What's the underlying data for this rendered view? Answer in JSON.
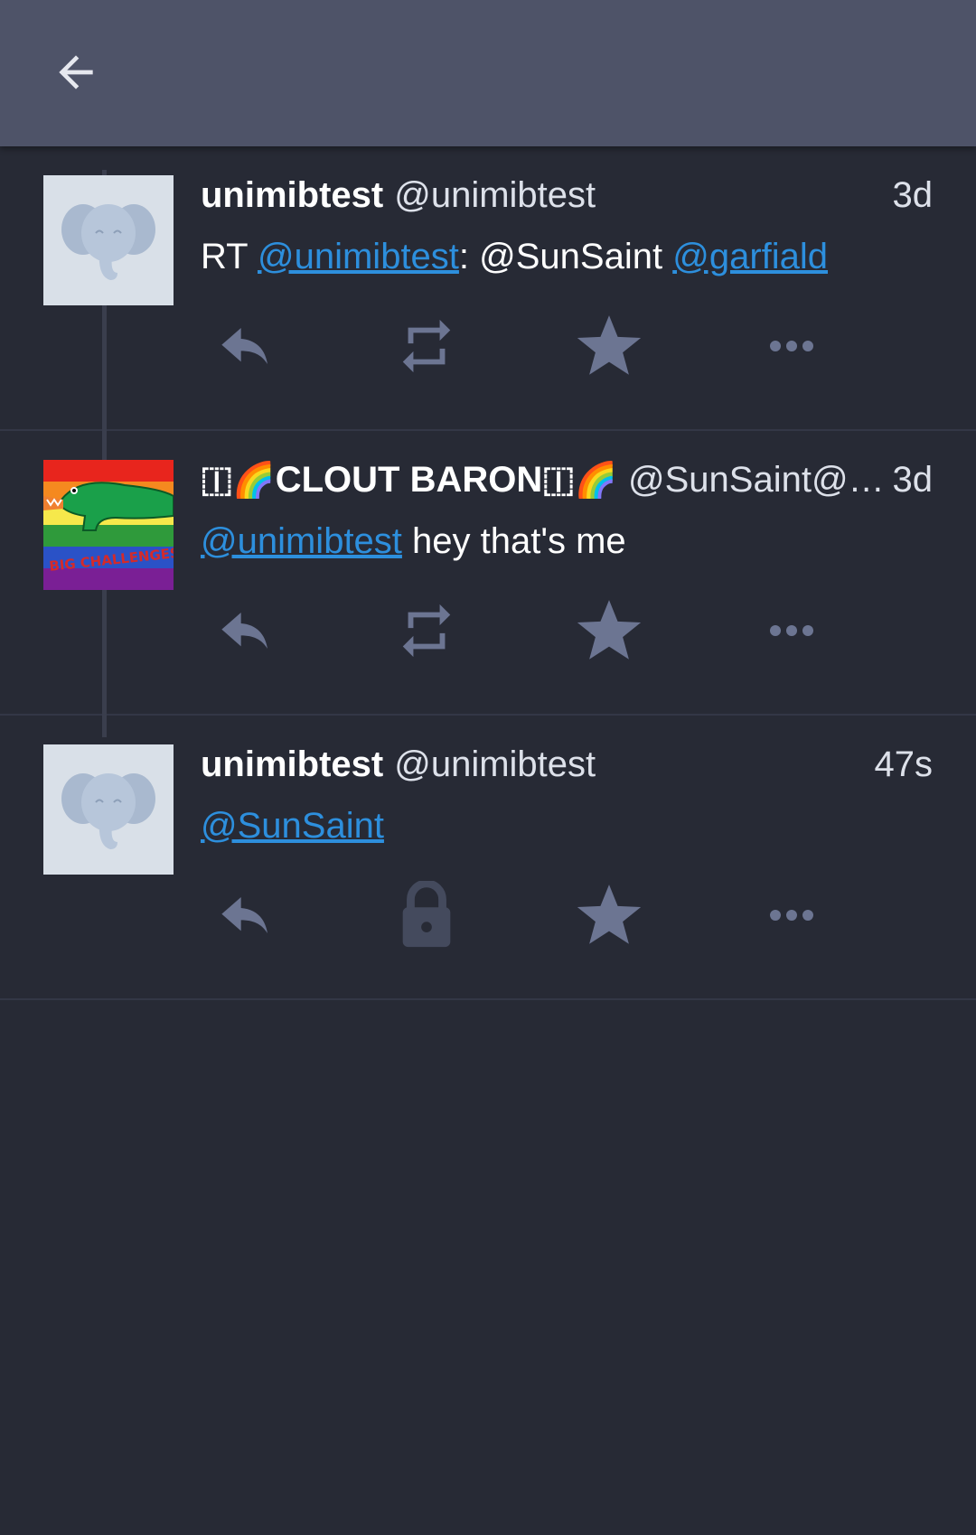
{
  "header": {
    "back_icon": "arrow-left-icon"
  },
  "colors": {
    "background": "#272a35",
    "header": "#4e5368",
    "link": "#2d8fdd",
    "action_icon": "#6c7592",
    "locked_icon": "#444a5d"
  },
  "posts": [
    {
      "display_name": "unimibtest",
      "acct": "@unimibtest",
      "time": "3d",
      "avatar": "elephant-avatar",
      "content": {
        "prefix": "RT ",
        "mention1": "@unimibtest",
        "middle": ": @SunSaint ",
        "mention2": "@garfiald"
      },
      "actions": [
        "reply-icon",
        "boost-icon",
        "favourite-icon",
        "more-icon"
      ]
    },
    {
      "display_name_parts": {
        "start": "🇮",
        "emoji1": "🌈",
        "name": "CLOUT BARON",
        "mid": "🇮",
        "emoji2": "🌈"
      },
      "acct": "@SunSaint@wit…",
      "time": "3d",
      "avatar": "crocodile-pride-avatar",
      "avatar_text": "BIG CHALLENGES",
      "content": {
        "mention1": "@unimibtest",
        "suffix": " hey that's me"
      },
      "actions": [
        "reply-icon",
        "boost-icon",
        "favourite-icon",
        "more-icon"
      ]
    },
    {
      "display_name": "unimibtest",
      "acct": "@unimibtest",
      "time": "47s",
      "avatar": "elephant-avatar",
      "content": {
        "mention1": "@SunSaint"
      },
      "actions": [
        "reply-icon",
        "lock-icon",
        "favourite-icon",
        "more-icon"
      ]
    }
  ]
}
